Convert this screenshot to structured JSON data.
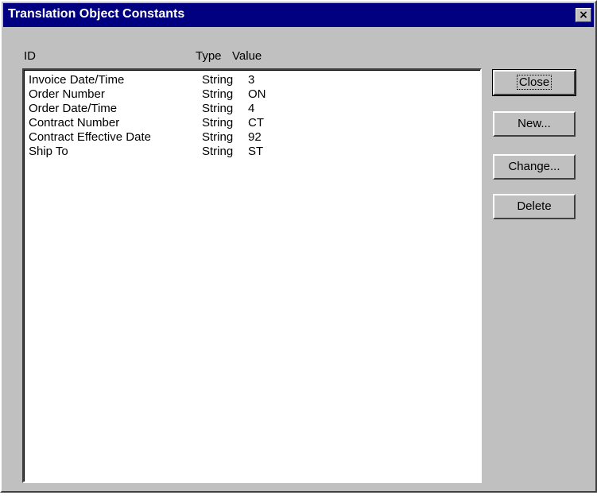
{
  "window": {
    "title": "Translation Object Constants",
    "close_icon": "×"
  },
  "columns": {
    "id": "ID",
    "type": "Type",
    "value": "Value"
  },
  "rows": [
    {
      "id": "Invoice Date/Time",
      "type": "String",
      "value": "3"
    },
    {
      "id": "Order Number",
      "type": "String",
      "value": "ON"
    },
    {
      "id": "Order Date/Time",
      "type": "String",
      "value": "4"
    },
    {
      "id": "Contract Number",
      "type": "String",
      "value": "CT"
    },
    {
      "id": "Contract Effective Date",
      "type": "String",
      "value": "92"
    },
    {
      "id": "Ship To",
      "type": "String",
      "value": "ST"
    }
  ],
  "buttons": {
    "close": "Close",
    "new": "New...",
    "change": "Change...",
    "delete": "Delete"
  }
}
